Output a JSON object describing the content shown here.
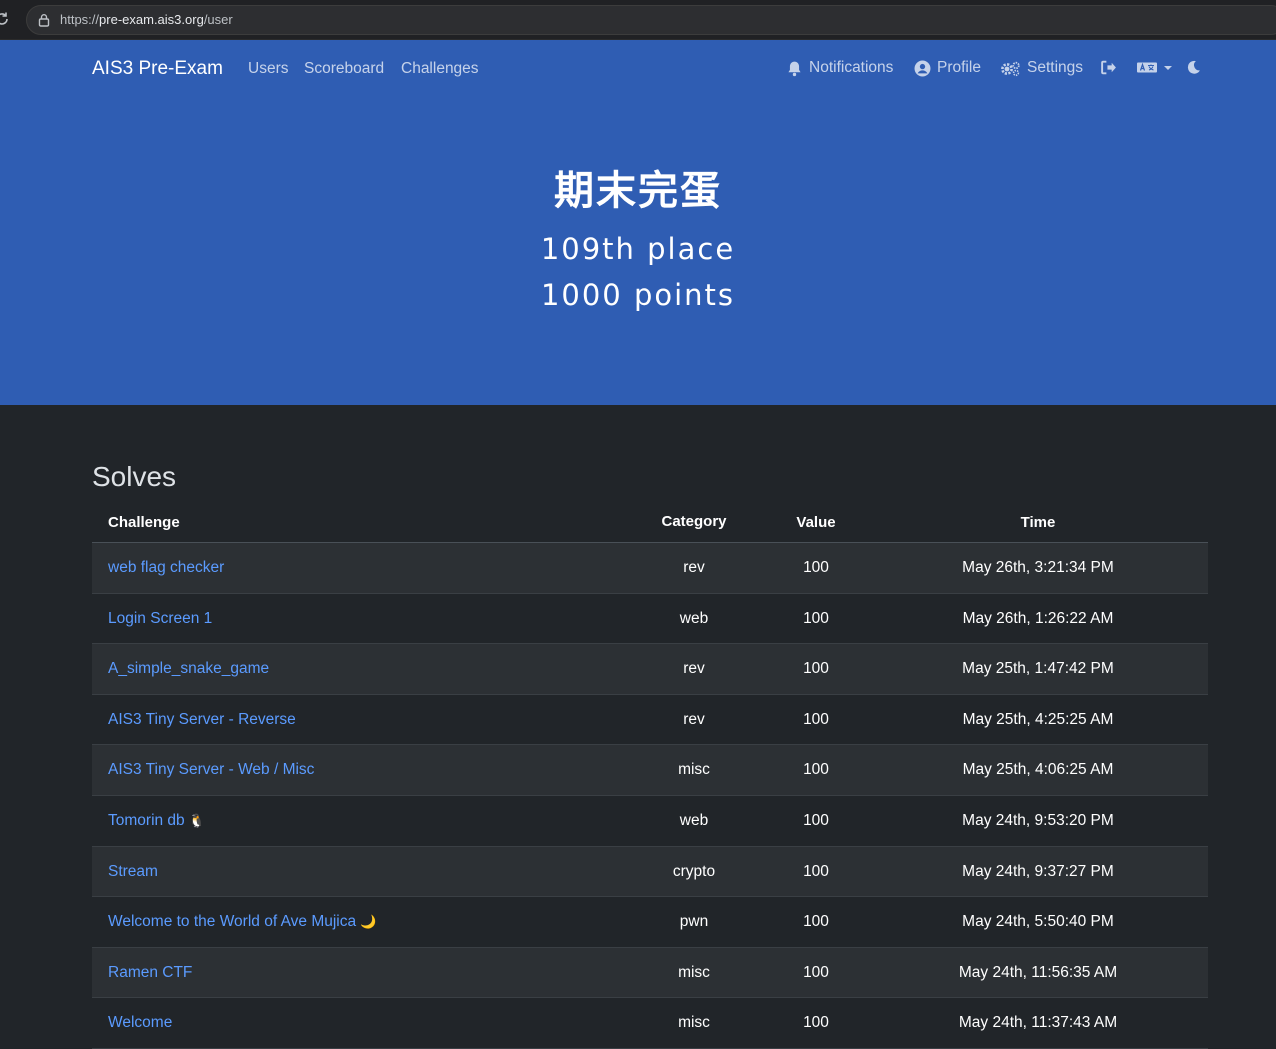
{
  "browser": {
    "url_scheme": "https://",
    "url_host": "pre-exam.ais3.org",
    "url_path": "/user"
  },
  "nav": {
    "brand": "AIS3 Pre-Exam",
    "links": [
      "Users",
      "Scoreboard",
      "Challenges"
    ],
    "notifications": "Notifications",
    "profile": "Profile",
    "settings": "Settings"
  },
  "hero": {
    "name": "期末完蛋",
    "place": "109th place",
    "points": "1000 points"
  },
  "solves": {
    "heading": "Solves",
    "columns": {
      "challenge": "Challenge",
      "category": "Category",
      "value": "Value",
      "time": "Time"
    },
    "rows": [
      {
        "challenge": "web flag checker",
        "emoji": "",
        "category": "rev",
        "value": "100",
        "time": "May 26th, 3:21:34 PM"
      },
      {
        "challenge": "Login Screen 1",
        "emoji": "",
        "category": "web",
        "value": "100",
        "time": "May 26th, 1:26:22 AM"
      },
      {
        "challenge": "A_simple_snake_game",
        "emoji": "",
        "category": "rev",
        "value": "100",
        "time": "May 25th, 1:47:42 PM"
      },
      {
        "challenge": "AIS3 Tiny Server - Reverse",
        "emoji": "",
        "category": "rev",
        "value": "100",
        "time": "May 25th, 4:25:25 AM"
      },
      {
        "challenge": "AIS3 Tiny Server - Web / Misc",
        "emoji": "",
        "category": "misc",
        "value": "100",
        "time": "May 25th, 4:06:25 AM"
      },
      {
        "challenge": "Tomorin db",
        "emoji": "🐧",
        "category": "web",
        "value": "100",
        "time": "May 24th, 9:53:20 PM"
      },
      {
        "challenge": "Stream",
        "emoji": "",
        "category": "crypto",
        "value": "100",
        "time": "May 24th, 9:37:27 PM"
      },
      {
        "challenge": "Welcome to the World of Ave Mujica",
        "emoji": "🌙",
        "category": "pwn",
        "value": "100",
        "time": "May 24th, 5:50:40 PM"
      },
      {
        "challenge": "Ramen CTF",
        "emoji": "",
        "category": "misc",
        "value": "100",
        "time": "May 24th, 11:56:35 AM"
      },
      {
        "challenge": "Welcome",
        "emoji": "",
        "category": "misc",
        "value": "100",
        "time": "May 24th, 11:37:43 AM"
      }
    ]
  },
  "colors": {
    "hero_bg": "#2f5db3",
    "page_bg": "#212529",
    "link": "#5b9bff"
  }
}
